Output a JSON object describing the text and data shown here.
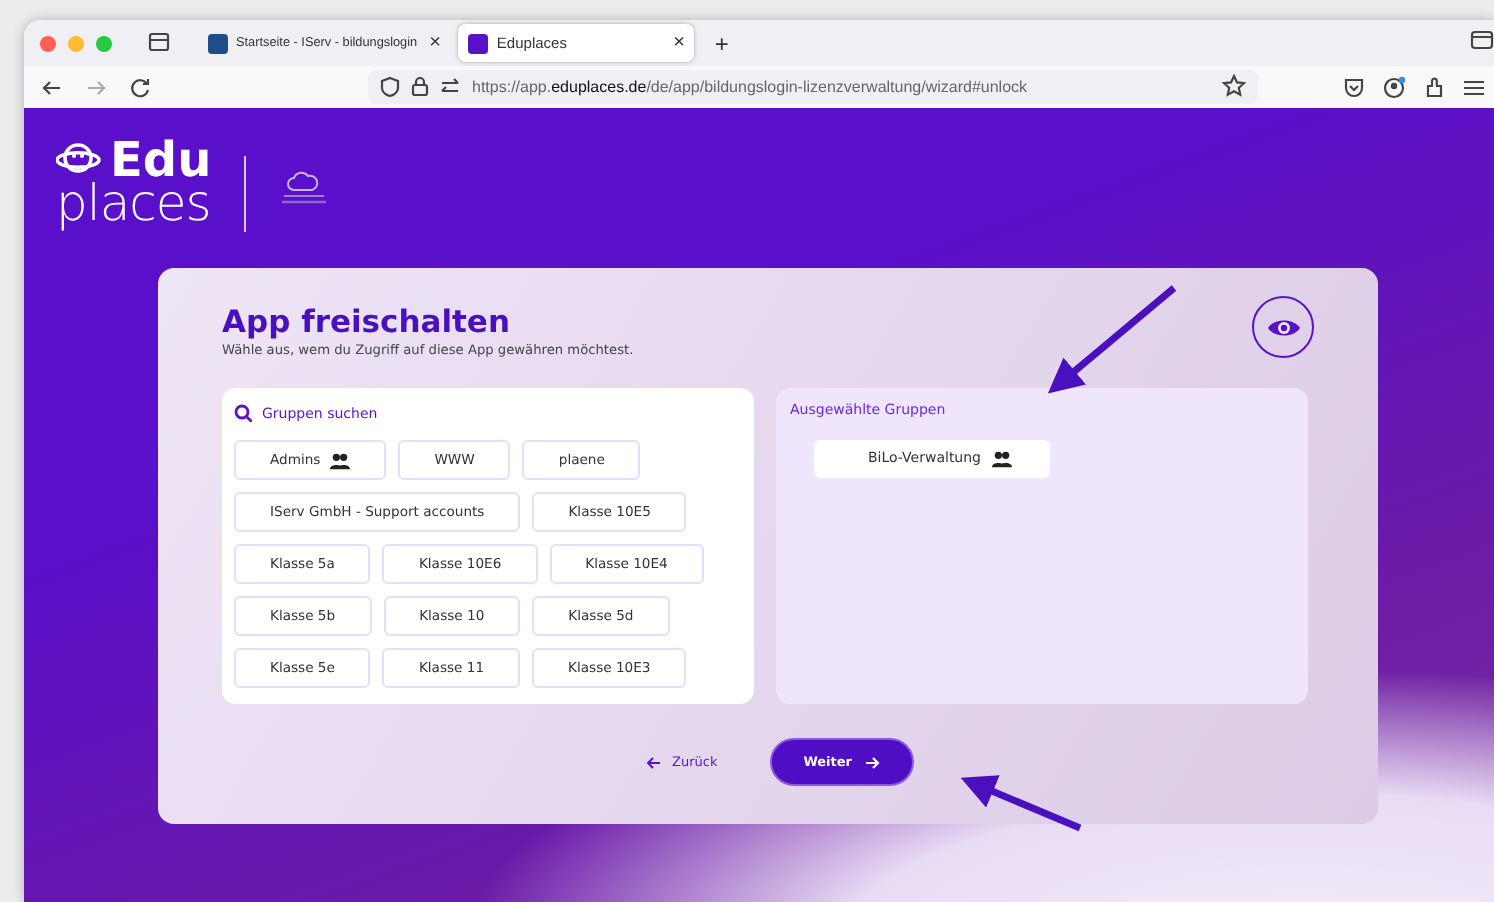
{
  "browser": {
    "tabs": [
      {
        "title": "Startseite - IServ - bildungslogin",
        "close": "×",
        "selected": false
      },
      {
        "title": "Eduplaces",
        "close": "×",
        "selected": true
      }
    ],
    "new_tab": "+",
    "url_prefix": "https://app.",
    "url_domain": "eduplaces.de",
    "url_path": "/de/app/bildungslogin-lizenzverwaltung/wizard#unlock"
  },
  "header": {
    "logo_top": "Edu",
    "logo_bottom": "places"
  },
  "card": {
    "title": "App freischalten",
    "subtitle": "Wähle aus, wem du Zugriff auf diese App gewähren möchtest.",
    "search": {
      "placeholder": "Gruppen suchen"
    },
    "group_rows": [
      [
        {
          "label": "Admins",
          "group_icon": true
        },
        {
          "label": "WWW",
          "group_icon": false
        },
        {
          "label": "plaene",
          "group_icon": false
        }
      ],
      [
        {
          "label": "IServ GmbH - Support accounts",
          "group_icon": false
        },
        {
          "label": "Klasse 10E5",
          "group_icon": false
        }
      ],
      [
        {
          "label": "Klasse 5a",
          "group_icon": false
        },
        {
          "label": "Klasse 10E6",
          "group_icon": false
        },
        {
          "label": "Klasse 10E4",
          "group_icon": false
        }
      ],
      [
        {
          "label": "Klasse 5b",
          "group_icon": false
        },
        {
          "label": "Klasse 10",
          "group_icon": false
        },
        {
          "label": "Klasse 5d",
          "group_icon": false
        }
      ],
      [
        {
          "label": "Klasse 5e",
          "group_icon": false
        },
        {
          "label": "Klasse 11",
          "group_icon": false
        },
        {
          "label": "Klasse 10E3",
          "group_icon": false
        }
      ]
    ],
    "selected_title": "Ausgewählte Gruppen",
    "selected_groups": [
      {
        "label": "BiLo-Verwaltung",
        "group_icon": true
      }
    ],
    "back_button": "Zurück",
    "next_button": "Weiter"
  }
}
